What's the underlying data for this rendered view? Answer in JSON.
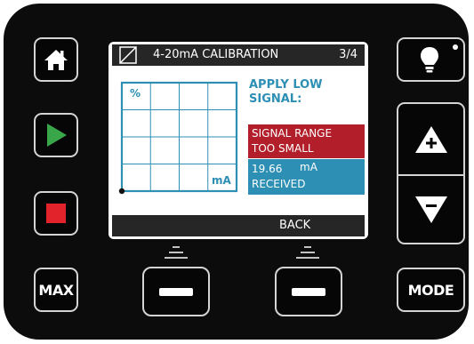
{
  "screen": {
    "title": "4-20mA CALIBRATION",
    "page_indicator": "3/4",
    "graph": {
      "y_label": "%",
      "x_label": "mA"
    },
    "instruction_line1": "APPLY LOW",
    "instruction_line2": "SIGNAL:",
    "error_line1": "SIGNAL RANGE",
    "error_line2": "TOO SMALL",
    "received_value": "19.66",
    "received_unit": "mA",
    "received_label": "RECEIVED",
    "softkey_right_label": "BACK"
  },
  "buttons": {
    "max_label": "MAX",
    "mode_label": "MODE"
  },
  "colors": {
    "accent_blue": "#2d8fb4",
    "error_red": "#b21f2a",
    "play_green": "#3aa64a",
    "stop_red": "#e3232b"
  },
  "icons": {
    "home": "home-icon",
    "play": "play-icon",
    "stop": "stop-icon",
    "light": "lightbulb-icon",
    "up": "triangle-up-plus-icon",
    "down": "triangle-down-minus-icon"
  }
}
